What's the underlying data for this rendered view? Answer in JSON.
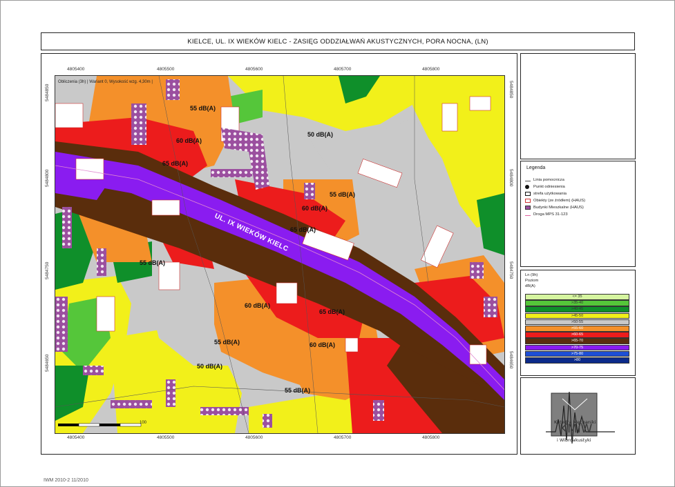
{
  "title": "KIELCE, UL. IX WIEKÓW KIELC - ZASIĘG ODDZIAŁWAŃ AKUSTYCZNYCH, PORA NOCNA, (LN)",
  "map": {
    "info_line": "Obliczenia (3h) | Wariant 0, Wysokość wzg. 4,30m |",
    "road_name": "UL. IX WIEKÓW KIELC",
    "contour_labels": [
      {
        "name": "label-55-top",
        "text": "55 dB(A)"
      },
      {
        "name": "label-60-left",
        "text": "60 dB(A)"
      },
      {
        "name": "label-65-left",
        "text": "65 dB(A)"
      },
      {
        "name": "label-50-top",
        "text": "50 dB(A)"
      },
      {
        "name": "label-55-mid",
        "text": "55 dB(A)"
      },
      {
        "name": "label-60-mid",
        "text": "60 dB(A)"
      },
      {
        "name": "label-65-mid",
        "text": "65 dB(A)"
      },
      {
        "name": "label-55-left",
        "text": "55 dB(A)"
      },
      {
        "name": "label-60-low",
        "text": "60 dB(A)"
      },
      {
        "name": "label-65-low",
        "text": "65 dB(A)"
      },
      {
        "name": "label-60-low2",
        "text": "60 dB(A)"
      },
      {
        "name": "label-55-low",
        "text": "55 dB(A)"
      },
      {
        "name": "label-50-low",
        "text": "50 dB(A)"
      },
      {
        "name": "label-55-bottom",
        "text": "55 dB(A)"
      }
    ],
    "scale_label": "100",
    "x_ticks": [
      "4805400",
      "4805500",
      "4805600",
      "4805700",
      "4805800"
    ],
    "y_ticks_left": [
      "5484850",
      "5484800",
      "5484750",
      "5484650"
    ],
    "y_ticks_right": [
      "5484850",
      "5484800",
      "5484750",
      "5484650"
    ]
  },
  "legend": {
    "title": "Legenda",
    "items": [
      {
        "label": "Linia pomocnicza",
        "symbol": "arrow-line-icon"
      },
      {
        "label": "Punkt odniesienia",
        "symbol": "reference-point-icon"
      },
      {
        "label": "strefa użytkowania",
        "symbol": "zone-icon"
      },
      {
        "label": "Obiekty (ze źródłem) (HAUS)",
        "symbol": "building-outline-icon"
      },
      {
        "label": "Budynki Mieszkalne (HAUS)",
        "symbol": "residential-building-icon"
      },
      {
        "label": "Droga MPS 31-123",
        "symbol": "road-line-icon"
      }
    ]
  },
  "scale": {
    "head": [
      "Ln (9h)",
      "Poziom",
      "dB(A)"
    ],
    "classes": [
      {
        "label": "<= 35",
        "color": "#d6f5a0"
      },
      {
        "label": ">35-40",
        "color": "#55c63a"
      },
      {
        "label": ">40-45",
        "color": "#0f8f2a"
      },
      {
        "label": ">45-50",
        "color": "#f2f01a"
      },
      {
        "label": ">50-55",
        "color": "#c9c9c9"
      },
      {
        "label": ">55-60",
        "color": "#f4902a"
      },
      {
        "label": ">60-65",
        "color": "#ec1c1c"
      },
      {
        "label": ">65-70",
        "color": "#5a2d0c"
      },
      {
        "label": ">70-75",
        "color": "#8a1cf0"
      },
      {
        "label": ">75-80",
        "color": "#1e4fd6"
      },
      {
        "label": ">80",
        "color": "#0c2a8a"
      }
    ]
  },
  "logo": {
    "line1": "Katedra Mechaniki",
    "abbr": "KMiW",
    "line2": "i Wibroakustyki"
  },
  "footer": "IWM 2010-2 11/2010"
}
